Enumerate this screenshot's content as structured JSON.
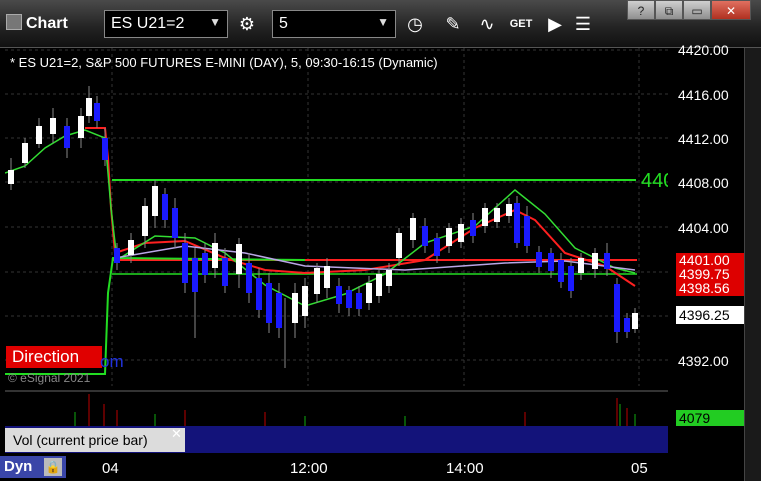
{
  "window": {
    "title": "Chart",
    "symbol": "ES U21=2",
    "interval": "5",
    "win_buttons": [
      "?",
      "⧉",
      "▭",
      "✕"
    ]
  },
  "chart": {
    "header": "* ES U21=2, S&P 500 FUTURES E-MINI (DAY), 5, 09:30-16:15 (Dynamic)",
    "direction_label": "Direction",
    "com_fragment": "om",
    "copyright": "© eSignal 2021",
    "line_fragment_label": "440",
    "y_ticks": [
      "4420.00",
      "4416.00",
      "4412.00",
      "4408.00",
      "4404.00",
      "4392.00"
    ],
    "tags": [
      {
        "text": "4401.00",
        "bg": "#dd0000",
        "fg": "#ffffff"
      },
      {
        "text": "4399.75",
        "bg": "#dd0000",
        "fg": "#ffffff"
      },
      {
        "text": "4398.56",
        "bg": "#dd0000",
        "fg": "#ffffff"
      },
      {
        "text": "4396.25",
        "bg": "#ffffff",
        "fg": "#000000"
      }
    ],
    "x_ticks": [
      "04",
      "12:00",
      "14:00",
      "05"
    ]
  },
  "volume": {
    "label": "Vol (current price bar)",
    "value": "4079"
  },
  "bottom": {
    "dyn_label": "Dyn"
  }
}
